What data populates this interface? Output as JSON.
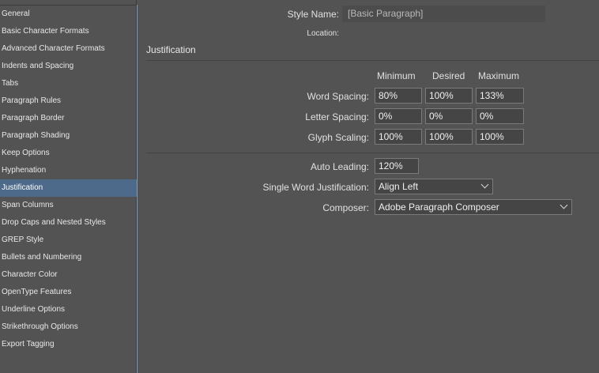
{
  "sidebar": {
    "items": [
      {
        "label": "General"
      },
      {
        "label": "Basic Character Formats"
      },
      {
        "label": "Advanced Character Formats"
      },
      {
        "label": "Indents and Spacing"
      },
      {
        "label": "Tabs"
      },
      {
        "label": "Paragraph Rules"
      },
      {
        "label": "Paragraph Border"
      },
      {
        "label": "Paragraph Shading"
      },
      {
        "label": "Keep Options"
      },
      {
        "label": "Hyphenation"
      },
      {
        "label": "Justification"
      },
      {
        "label": "Span Columns"
      },
      {
        "label": "Drop Caps and Nested Styles"
      },
      {
        "label": "GREP Style"
      },
      {
        "label": "Bullets and Numbering"
      },
      {
        "label": "Character Color"
      },
      {
        "label": "OpenType Features"
      },
      {
        "label": "Underline Options"
      },
      {
        "label": "Strikethrough Options"
      },
      {
        "label": "Export Tagging"
      }
    ],
    "selected": "Justification"
  },
  "header": {
    "style_name_label": "Style Name:",
    "style_name_value": "[Basic Paragraph]",
    "location_label": "Location:"
  },
  "section": {
    "title": "Justification"
  },
  "grid": {
    "columns": [
      "Minimum",
      "Desired",
      "Maximum"
    ],
    "rows": [
      {
        "label": "Word Spacing:",
        "values": [
          "80%",
          "100%",
          "133%"
        ]
      },
      {
        "label": "Letter Spacing:",
        "values": [
          "0%",
          "0%",
          "0%"
        ]
      },
      {
        "label": "Glyph Scaling:",
        "values": [
          "100%",
          "100%",
          "100%"
        ]
      }
    ]
  },
  "options": {
    "auto_leading_label": "Auto Leading:",
    "auto_leading_value": "120%",
    "single_word_label": "Single Word Justification:",
    "single_word_value": "Align Left",
    "composer_label": "Composer:",
    "composer_value": "Adobe Paragraph Composer"
  },
  "colors": {
    "background": "#535353",
    "selected_item": "#4e6a8a",
    "field_bg": "#454545",
    "field_border": "#7a7a7a"
  }
}
